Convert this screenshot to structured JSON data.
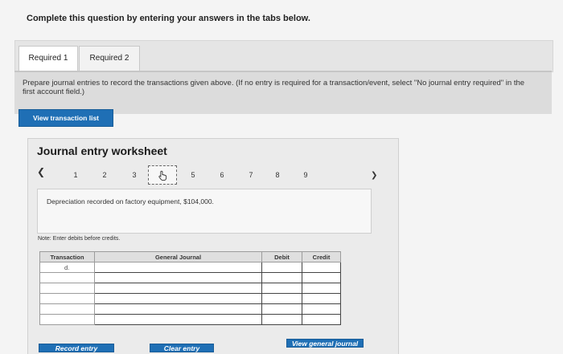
{
  "instruction": "Complete this question by entering your answers in the tabs below.",
  "tabs": [
    {
      "label": "Required 1",
      "active": true
    },
    {
      "label": "Required 2",
      "active": false
    }
  ],
  "prompt": "Prepare journal entries to record the transactions given above. (If no entry is required for a transaction/event, select \"No journal entry required\" in the first account field.)",
  "view_transaction_list": "View transaction list",
  "worksheet": {
    "title": "Journal entry worksheet",
    "pages": [
      "1",
      "2",
      "3",
      "4",
      "5",
      "6",
      "7",
      "8",
      "9"
    ],
    "current_page": "4",
    "current_page_icon": "hand-pointer-icon",
    "description": "Depreciation recorded on factory equipment, $104,000.",
    "note": "Note: Enter debits before credits.",
    "columns": {
      "transaction": "Transaction",
      "journal": "General Journal",
      "debit": "Debit",
      "credit": "Credit"
    },
    "rows": [
      {
        "transaction": "d.",
        "account": "",
        "debit": "",
        "credit": ""
      },
      {
        "transaction": "",
        "account": "",
        "debit": "",
        "credit": ""
      },
      {
        "transaction": "",
        "account": "",
        "debit": "",
        "credit": ""
      },
      {
        "transaction": "",
        "account": "",
        "debit": "",
        "credit": ""
      },
      {
        "transaction": "",
        "account": "",
        "debit": "",
        "credit": ""
      },
      {
        "transaction": "",
        "account": "",
        "debit": "",
        "credit": ""
      }
    ]
  },
  "buttons": {
    "record_entry": "Record entry",
    "clear_entry": "Clear entry",
    "view_general_journal": "View general journal"
  },
  "colors": {
    "button_blue": "#1f6fb5"
  }
}
